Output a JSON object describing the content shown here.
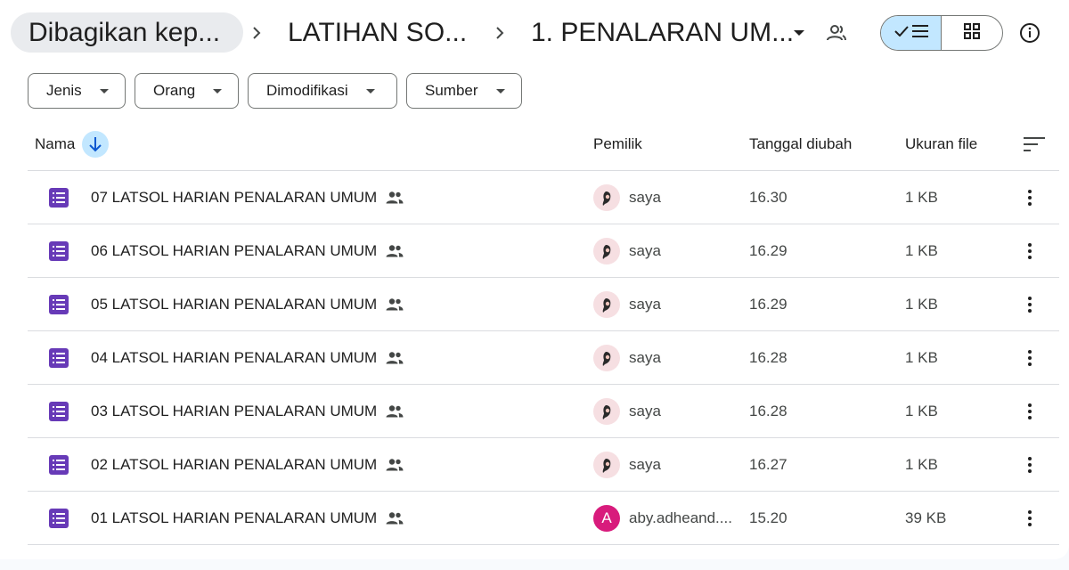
{
  "breadcrumb": {
    "items": [
      "Dibagikan kep...",
      "LATIHAN SO...",
      "1. PENALARAN UM..."
    ]
  },
  "icons": {
    "separator": "chevron-right-icon",
    "dropdown": "arrow-drop-down-icon",
    "share": "share-people-icon",
    "list_view": "list-view-check-icon",
    "grid_view": "grid-view-icon",
    "info": "info-icon",
    "sort": "arrow-down-icon",
    "sort_options": "sort-options-icon",
    "file": "google-forms-icon",
    "shared": "shared-people-icon",
    "more": "more-vert-icon"
  },
  "filters": [
    {
      "label": "Jenis"
    },
    {
      "label": "Orang"
    },
    {
      "label": "Dimodifikasi"
    },
    {
      "label": "Sumber"
    }
  ],
  "table": {
    "columns": {
      "name": "Nama",
      "owner": "Pemilik",
      "modified": "Tanggal diubah",
      "size": "Ukuran file"
    },
    "rows": [
      {
        "name": "07 LATSOL HARIAN PENALARAN UMUM",
        "owner": "saya",
        "owner_avatar": "photo",
        "modified": "16.30",
        "size": "1 KB"
      },
      {
        "name": "06 LATSOL HARIAN PENALARAN UMUM",
        "owner": "saya",
        "owner_avatar": "photo",
        "modified": "16.29",
        "size": "1 KB"
      },
      {
        "name": "05 LATSOL HARIAN PENALARAN UMUM",
        "owner": "saya",
        "owner_avatar": "photo",
        "modified": "16.29",
        "size": "1 KB"
      },
      {
        "name": "04 LATSOL HARIAN PENALARAN UMUM",
        "owner": "saya",
        "owner_avatar": "photo",
        "modified": "16.28",
        "size": "1 KB"
      },
      {
        "name": "03 LATSOL HARIAN PENALARAN UMUM",
        "owner": "saya",
        "owner_avatar": "photo",
        "modified": "16.28",
        "size": "1 KB"
      },
      {
        "name": "02 LATSOL HARIAN PENALARAN UMUM",
        "owner": "saya",
        "owner_avatar": "photo",
        "modified": "16.27",
        "size": "1 KB"
      },
      {
        "name": "01 LATSOL HARIAN PENALARAN UMUM",
        "owner": "aby.adheand....",
        "owner_avatar": "A",
        "modified": "15.20",
        "size": "39 KB"
      }
    ]
  },
  "colors": {
    "forms_purple": "#673ab7",
    "selected_toggle": "#c2e7ff",
    "avatar_letter_bg": "#d81b7c"
  }
}
